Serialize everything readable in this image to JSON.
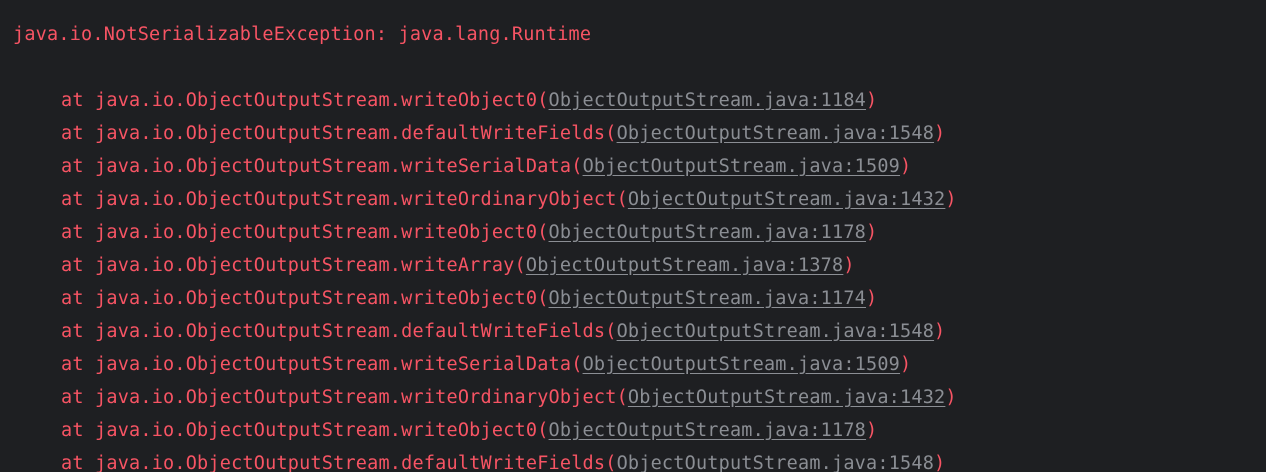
{
  "colors": {
    "background": "#1e1f22",
    "error_text": "#f75464",
    "link_text": "#8b8e94"
  },
  "console": {
    "exception": "java.io.NotSerializableException: java.lang.Runtime",
    "frames": [
      {
        "method": "at java.io.ObjectOutputStream.writeObject0",
        "source": "ObjectOutputStream.java:1184"
      },
      {
        "method": "at java.io.ObjectOutputStream.defaultWriteFields",
        "source": "ObjectOutputStream.java:1548"
      },
      {
        "method": "at java.io.ObjectOutputStream.writeSerialData",
        "source": "ObjectOutputStream.java:1509"
      },
      {
        "method": "at java.io.ObjectOutputStream.writeOrdinaryObject",
        "source": "ObjectOutputStream.java:1432"
      },
      {
        "method": "at java.io.ObjectOutputStream.writeObject0",
        "source": "ObjectOutputStream.java:1178"
      },
      {
        "method": "at java.io.ObjectOutputStream.writeArray",
        "source": "ObjectOutputStream.java:1378"
      },
      {
        "method": "at java.io.ObjectOutputStream.writeObject0",
        "source": "ObjectOutputStream.java:1174"
      },
      {
        "method": "at java.io.ObjectOutputStream.defaultWriteFields",
        "source": "ObjectOutputStream.java:1548"
      },
      {
        "method": "at java.io.ObjectOutputStream.writeSerialData",
        "source": "ObjectOutputStream.java:1509"
      },
      {
        "method": "at java.io.ObjectOutputStream.writeOrdinaryObject",
        "source": "ObjectOutputStream.java:1432"
      },
      {
        "method": "at java.io.ObjectOutputStream.writeObject0",
        "source": "ObjectOutputStream.java:1178"
      },
      {
        "method": "at java.io.ObjectOutputStream.defaultWriteFields",
        "source": "ObjectOutputStream.java:1548"
      }
    ]
  }
}
